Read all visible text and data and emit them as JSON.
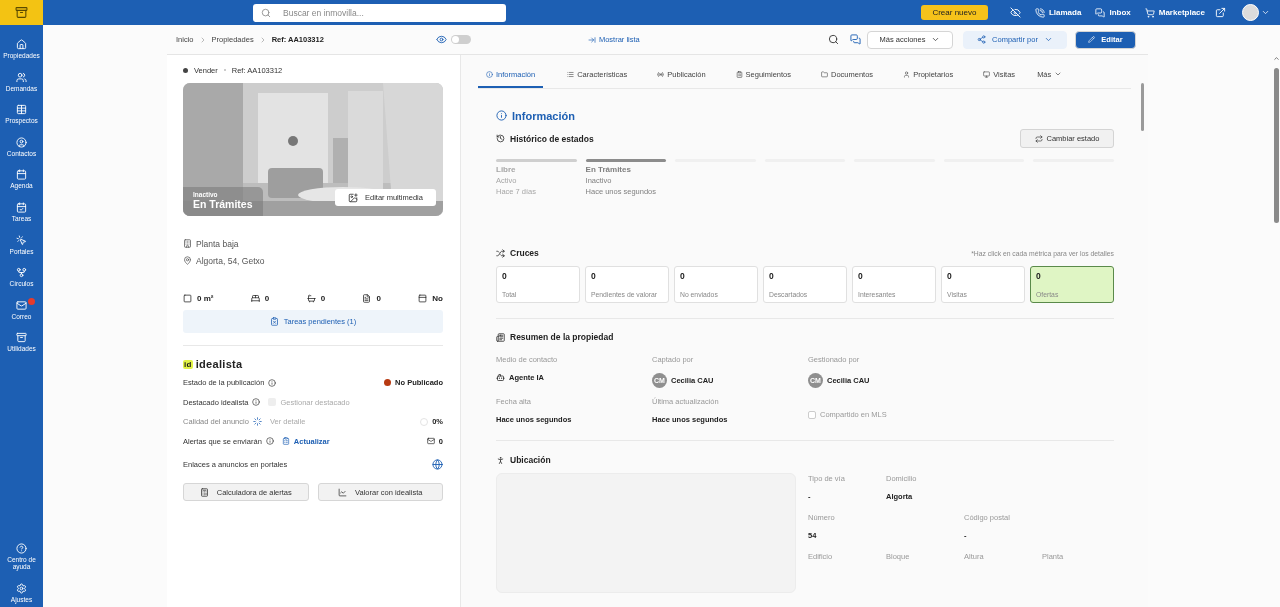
{
  "topbar": {
    "search_placeholder": "Buscar en inmovilla...",
    "create_button": "Crear nuevo",
    "actions": [
      {
        "label": "Llamada"
      },
      {
        "label": "Inbox"
      },
      {
        "label": "Marketplace"
      }
    ]
  },
  "sidebar": {
    "items": [
      {
        "label": "Propiedades",
        "badge": false
      },
      {
        "label": "Demandas",
        "badge": false
      },
      {
        "label": "Prospectos",
        "badge": false
      },
      {
        "label": "Contactos",
        "badge": false
      },
      {
        "label": "Agenda",
        "badge": false
      },
      {
        "label": "Tareas",
        "badge": false
      },
      {
        "label": "Portales",
        "badge": false
      },
      {
        "label": "Círculos",
        "badge": false
      },
      {
        "label": "Correo",
        "badge": true
      },
      {
        "label": "Utilidades",
        "badge": false
      }
    ],
    "footer_items": [
      {
        "label": "Centro de ayuda"
      },
      {
        "label": "Ajustes"
      }
    ]
  },
  "header": {
    "breadcrumb": [
      "Inicio",
      "Propiedades",
      "Ref: AA103312"
    ],
    "preview_toggle_on": false,
    "show_list": "Mostrar lista",
    "more_actions": "Más acciones",
    "share": "Compartir por",
    "edit": "Editar"
  },
  "property": {
    "operation": "Vender",
    "reference": "Ref: AA103312",
    "photo": {
      "kind": "picture",
      "status": "Inactivo",
      "state": "En Trámites",
      "edit_button": "Editar multimedia"
    },
    "details": [
      {
        "kind": "floor",
        "text": "Planta baja"
      },
      {
        "kind": "address",
        "text": "Algorta, 54, Getxo"
      }
    ],
    "features": [
      {
        "kind": "area",
        "value": "0 m²"
      },
      {
        "kind": "bedrooms",
        "value": "0"
      },
      {
        "kind": "bathrooms",
        "value": "0"
      },
      {
        "kind": "rooms",
        "value": "0"
      },
      {
        "kind": "elevator",
        "value": "No"
      }
    ],
    "pending_tasks": "Tareas pendientes (1)"
  },
  "idealista": {
    "logo_mark": "id",
    "logo_text": "idealista",
    "rows": [
      {
        "kind": "status",
        "label": "Estado de la publicación",
        "value": "No Publicado",
        "color": "#b83a12"
      },
      {
        "kind": "featured",
        "label": "Destacado idealista",
        "action": "Gestionar destacado",
        "disabled": true
      },
      {
        "kind": "quality",
        "label": "Calidad del anuncio",
        "action": "Ver detalle",
        "value": "0%",
        "disabled": true
      },
      {
        "kind": "alerts",
        "label": "Alertas que se enviarán",
        "action": "Actualizar",
        "value": "0",
        "disabled": false
      },
      {
        "kind": "links",
        "label": "Enlaces a anuncios en portales"
      }
    ],
    "buttons": [
      "Calculadora de alertas",
      "Valorar con idealista"
    ]
  },
  "tabs": [
    {
      "label": "Información",
      "selected": true
    },
    {
      "label": "Características",
      "selected": false
    },
    {
      "label": "Publicación",
      "selected": false
    },
    {
      "label": "Seguimientos",
      "selected": false
    },
    {
      "label": "Documentos",
      "selected": false
    },
    {
      "label": "Propietarios",
      "selected": false
    },
    {
      "label": "Visitas",
      "selected": false
    },
    {
      "label": "Más",
      "selected": false
    }
  ],
  "information": {
    "title": "Información",
    "history": {
      "title": "Histórico de estados",
      "change_button": "Cambiar estado",
      "states": [
        {
          "name": "Libre",
          "status": "Activo",
          "time": "Hace 7 días",
          "current": false
        },
        {
          "name": "En Trámites",
          "status": "Inactivo",
          "time": "Hace unos segundos",
          "current": true
        }
      ]
    },
    "matches": {
      "title": "Cruces",
      "hint": "*Haz click en cada métrica para ver los detalles",
      "metrics": [
        {
          "value": "0",
          "label": "Total",
          "selected": false
        },
        {
          "value": "0",
          "label": "Pendientes de valorar",
          "selected": false
        },
        {
          "value": "0",
          "label": "No enviados",
          "selected": false
        },
        {
          "value": "0",
          "label": "Descartados",
          "selected": false
        },
        {
          "value": "0",
          "label": "Interesantes",
          "selected": false
        },
        {
          "value": "0",
          "label": "Visitas",
          "selected": false
        },
        {
          "value": "0",
          "label": "Ofertas",
          "selected": true
        }
      ]
    },
    "summary": {
      "title": "Resumen de la propiedad",
      "fields": [
        {
          "kind": "channel",
          "label": "Medio de contacto",
          "value": "Agente IA"
        },
        {
          "kind": "person",
          "label": "Captado por",
          "value": "Cecilia CAU",
          "initials": "CM"
        },
        {
          "kind": "person",
          "label": "Gestionado por",
          "value": "Cecilia CAU",
          "initials": "CM"
        },
        {
          "kind": "plain",
          "label": "Fecha alta",
          "value": "Hace unos segundos"
        },
        {
          "kind": "plain",
          "label": "Última actualización",
          "value": "Hace unos segundos"
        },
        {
          "kind": "checkbox",
          "label": "Compartido en MLS",
          "checked": false
        }
      ]
    },
    "location": {
      "title": "Ubicación",
      "rows": [
        [
          {
            "label": "Tipo de vía",
            "value": "-"
          },
          {
            "label": "Domicilio",
            "value": "Algorta"
          }
        ],
        [
          {
            "label": "Número",
            "value": "54"
          },
          null,
          {
            "label": "Código postal",
            "value": "-"
          }
        ],
        [
          {
            "label": "Edificio"
          },
          {
            "label": "Bloque"
          },
          {
            "label": "Altura"
          },
          {
            "label": "Planta"
          }
        ]
      ]
    }
  }
}
